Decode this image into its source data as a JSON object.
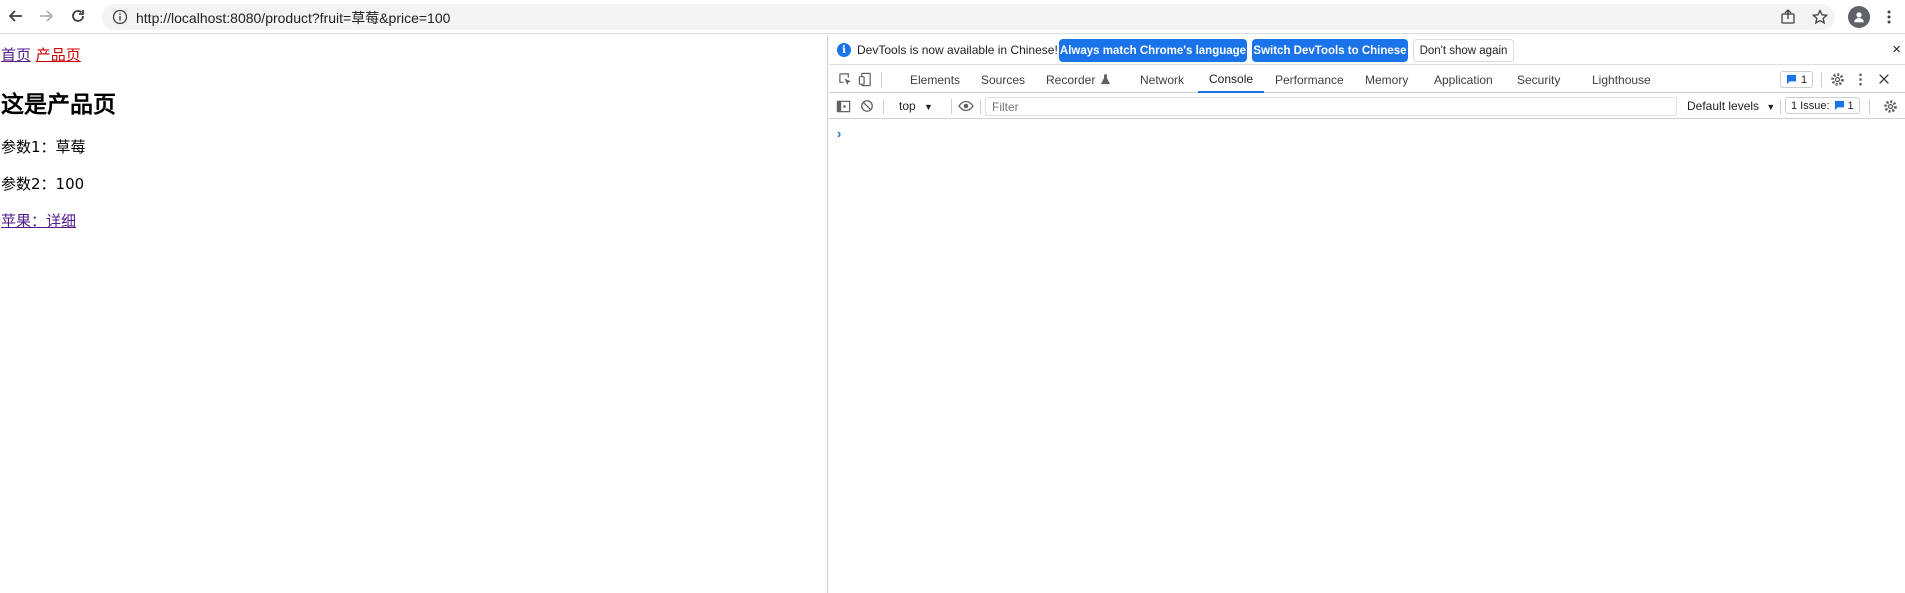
{
  "browser": {
    "url": "http://localhost:8080/product?fruit=草莓&price=100"
  },
  "page": {
    "nav": {
      "home": "首页",
      "product": "产品页"
    },
    "heading": "这是产品页",
    "param1": "参数1：草莓",
    "param2": "参数2：100",
    "detail_link": "苹果：详细"
  },
  "devtools": {
    "infobar": {
      "message": "DevTools is now available in Chinese!",
      "btn_match": "Always match Chrome's language",
      "btn_switch": "Switch DevTools to Chinese",
      "btn_dismiss": "Don't show again",
      "close": "×"
    },
    "tabs": [
      "Elements",
      "Sources",
      "Recorder",
      "Network",
      "Console",
      "Performance",
      "Memory",
      "Application",
      "Security",
      "Lighthouse"
    ],
    "active_tab": "Console",
    "messages_badge": "1",
    "console": {
      "context": "top",
      "filter_placeholder": "Filter",
      "levels": "Default levels",
      "issues_label": "1 Issue:",
      "issues_count": "1",
      "prompt": "›"
    },
    "accent_color": "#1a73e8"
  }
}
